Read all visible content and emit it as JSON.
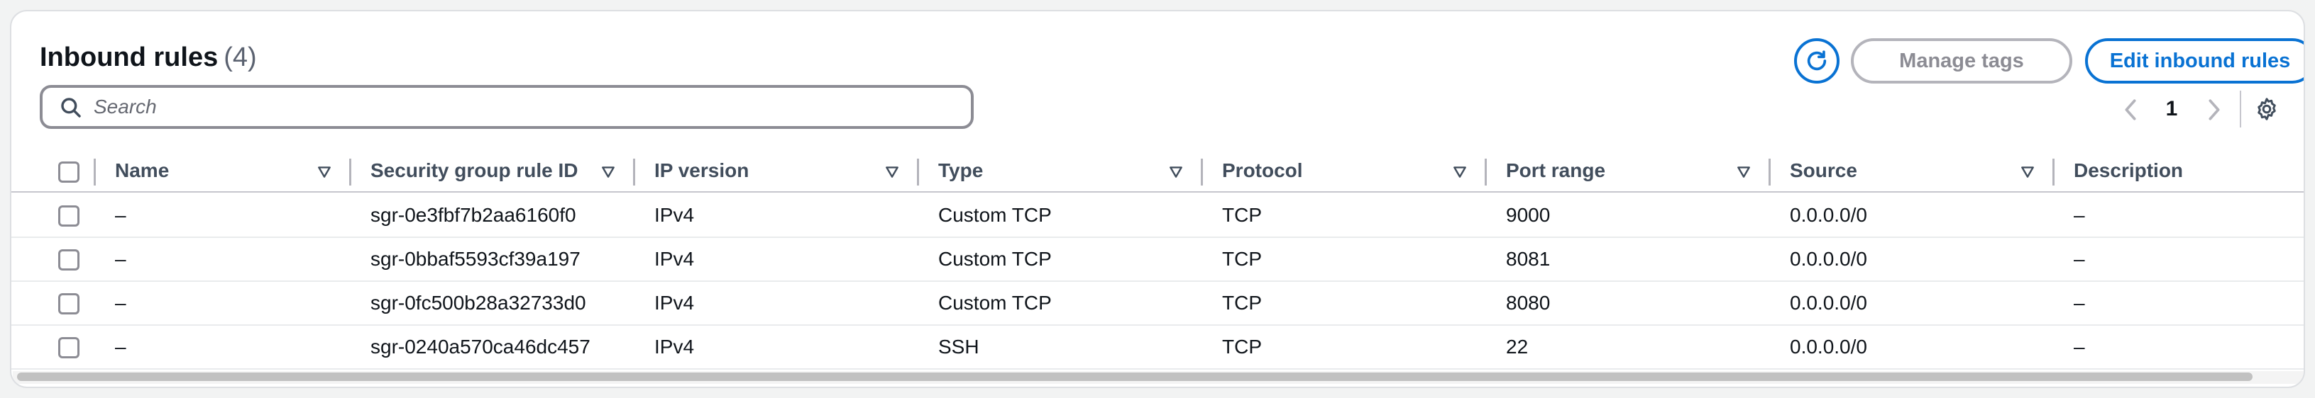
{
  "header": {
    "title": "Inbound rules",
    "count": "(4)"
  },
  "actions": {
    "manage_tags_label": "Manage tags",
    "edit_label": "Edit inbound rules"
  },
  "search": {
    "placeholder": "Search",
    "value": ""
  },
  "pagination": {
    "current_page": "1"
  },
  "table": {
    "columns": [
      "Name",
      "Security group rule ID",
      "IP version",
      "Type",
      "Protocol",
      "Port range",
      "Source",
      "Description"
    ],
    "rows": [
      {
        "name": "–",
        "rule_id": "sgr-0e3fbf7b2aa6160f0",
        "ip_version": "IPv4",
        "type": "Custom TCP",
        "protocol": "TCP",
        "port_range": "9000",
        "source": "0.0.0.0/0",
        "description": "–"
      },
      {
        "name": "–",
        "rule_id": "sgr-0bbaf5593cf39a197",
        "ip_version": "IPv4",
        "type": "Custom TCP",
        "protocol": "TCP",
        "port_range": "8081",
        "source": "0.0.0.0/0",
        "description": "–"
      },
      {
        "name": "–",
        "rule_id": "sgr-0fc500b28a32733d0",
        "ip_version": "IPv4",
        "type": "Custom TCP",
        "protocol": "TCP",
        "port_range": "8080",
        "source": "0.0.0.0/0",
        "description": "–"
      },
      {
        "name": "–",
        "rule_id": "sgr-0240a570ca46dc457",
        "ip_version": "IPv4",
        "type": "SSH",
        "protocol": "TCP",
        "port_range": "22",
        "source": "0.0.0.0/0",
        "description": "–"
      }
    ]
  },
  "icons": {
    "refresh": "refresh-icon",
    "search": "search-icon",
    "prev": "chevron-left-icon",
    "next": "chevron-right-icon",
    "settings": "gear-icon",
    "sort": "sort-caret-down-icon"
  },
  "colors": {
    "accent": "#0972d3",
    "disabled": "#8c8c94",
    "text": "#0f141a",
    "muted": "#5b6270"
  }
}
